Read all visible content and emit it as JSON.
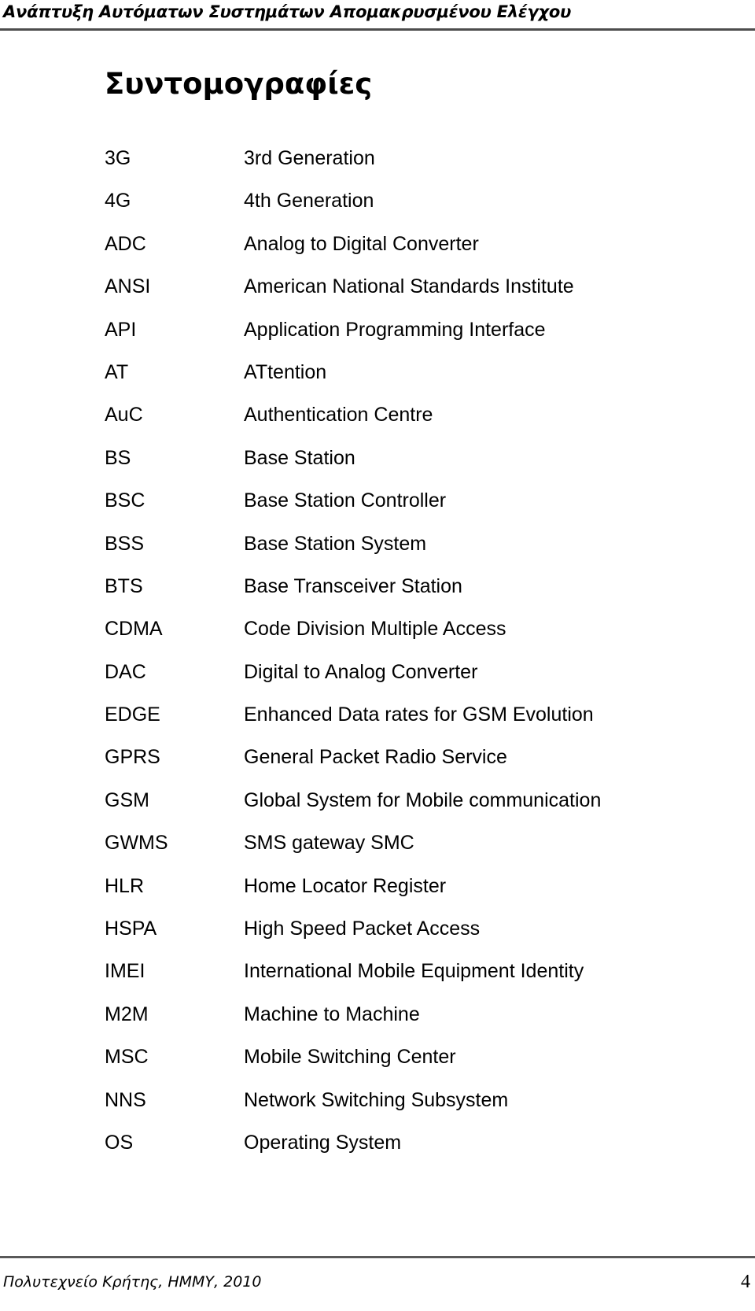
{
  "header": {
    "running_title": "Ανάπτυξη Αυτόματων Συστημάτων Απομακρυσμένου Ελέγχου"
  },
  "document": {
    "title": "Συντομογραφίες"
  },
  "abbreviations": [
    {
      "term": "3G",
      "definition": "3rd Generation"
    },
    {
      "term": "4G",
      "definition": "4th Generation"
    },
    {
      "term": "ADC",
      "definition": "Analog to Digital Converter"
    },
    {
      "term": "ANSI",
      "definition": "American National Standards Institute"
    },
    {
      "term": "API",
      "definition": "Application Programming Interface"
    },
    {
      "term": "AT",
      "definition": "ATtention"
    },
    {
      "term": "AuC",
      "definition": "Authentication Centre"
    },
    {
      "term": "BS",
      "definition": "Base Station"
    },
    {
      "term": "BSC",
      "definition": "Base Station Controller"
    },
    {
      "term": "BSS",
      "definition": "Base Station System"
    },
    {
      "term": "BTS",
      "definition": "Base Transceiver Station"
    },
    {
      "term": "CDMA",
      "definition": "Code Division Multiple Access"
    },
    {
      "term": "DAC",
      "definition": "Digital to Analog Converter"
    },
    {
      "term": "EDGE",
      "definition": "Enhanced Data rates for GSM Evolution"
    },
    {
      "term": "GPRS",
      "definition": "General Packet Radio Service"
    },
    {
      "term": "GSM",
      "definition": "Global System for Mobile communication"
    },
    {
      "term": "GWMS",
      "definition": "SMS gateway SMC"
    },
    {
      "term": "HLR",
      "definition": "Home Locator Register"
    },
    {
      "term": "HSPA",
      "definition": "High Speed Packet Access"
    },
    {
      "term": "IMEI",
      "definition": "International Mobile Equipment Identity"
    },
    {
      "term": "M2M",
      "definition": "Machine to Machine"
    },
    {
      "term": "MSC",
      "definition": "Mobile Switching Center"
    },
    {
      "term": "NNS",
      "definition": "Network Switching Subsystem"
    },
    {
      "term": "OS",
      "definition": "Operating System"
    }
  ],
  "footer": {
    "institution": "Πολυτεχνείο Κρήτης, ΗΜΜΥ, 2010",
    "page_number": "4"
  },
  "colors": {
    "text": "#000000",
    "rule": "#4d4d4d",
    "page_background": "#ffffff"
  }
}
